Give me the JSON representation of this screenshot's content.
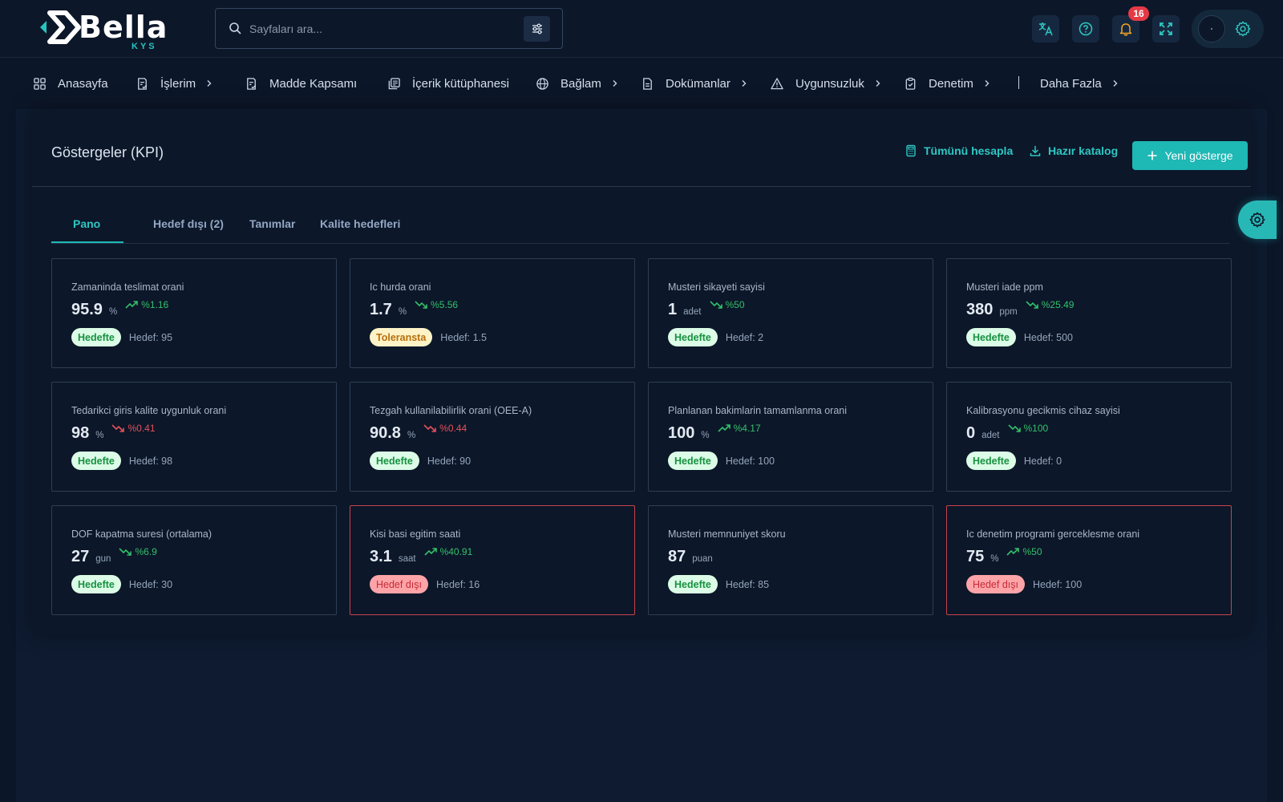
{
  "header": {
    "logo": {
      "name": "Bella",
      "sub": "KYS"
    },
    "search": {
      "placeholder": "Sayfaları ara..."
    },
    "notification_count": "16",
    "icons": [
      "translate-icon",
      "help-icon",
      "bell-icon",
      "fullscreen-icon",
      "gear-icon"
    ]
  },
  "nav": {
    "items": [
      {
        "label": "Anasayfa",
        "icon": "grid-icon",
        "chevron": false
      },
      {
        "label": "İşlerim",
        "icon": "task-icon",
        "chevron": true
      },
      {
        "label": "Madde Kapsamı",
        "icon": "checklist-icon",
        "chevron": false
      },
      {
        "label": "İçerik kütüphanesi",
        "icon": "library-icon",
        "chevron": false
      },
      {
        "label": "Bağlam",
        "icon": "globe-icon",
        "chevron": true
      },
      {
        "label": "Dokümanlar",
        "icon": "document-icon",
        "chevron": true
      },
      {
        "label": "Uygunsuzluk",
        "icon": "warning-icon",
        "chevron": true
      },
      {
        "label": "Denetim",
        "icon": "clipboard-icon",
        "chevron": true
      },
      {
        "label": "Daha Fazla",
        "icon": "",
        "chevron": true
      }
    ]
  },
  "page": {
    "title": "Göstergeler (KPI)",
    "actions": {
      "calculate_all": "Tümünü hesapla",
      "catalog": "Hazır katalog",
      "new_kpi": "Yeni gösterge"
    },
    "tabs": [
      {
        "label": "Pano",
        "active": true
      },
      {
        "label": "Hedef dışı (2)",
        "active": false
      },
      {
        "label": "Tanımlar",
        "active": false
      },
      {
        "label": "Kalite hedefleri",
        "active": false
      }
    ]
  },
  "colors": {
    "accent": "#1eb8b5",
    "trend_up": "#33c06a",
    "trend_down": "#e3515b",
    "alert_border": "#c8434d"
  },
  "kpis": [
    {
      "title": "Zamaninda teslimat orani",
      "value": "95.9",
      "unit": "%",
      "trend": "up",
      "change": "%1.16",
      "status": "Hedefte",
      "status_type": "ok",
      "target": "Hedef: 95",
      "alert": false
    },
    {
      "title": "Ic hurda orani",
      "value": "1.7",
      "unit": "%",
      "trend": "down-good",
      "change": "%5.56",
      "status": "Toleransta",
      "status_type": "warn",
      "target": "Hedef: 1.5",
      "alert": false
    },
    {
      "title": "Musteri sikayeti sayisi",
      "value": "1",
      "unit": "adet",
      "trend": "down-good",
      "change": "%50",
      "status": "Hedefte",
      "status_type": "ok",
      "target": "Hedef: 2",
      "alert": false
    },
    {
      "title": "Musteri iade ppm",
      "value": "380",
      "unit": "ppm",
      "trend": "down-good",
      "change": "%25.49",
      "status": "Hedefte",
      "status_type": "ok",
      "target": "Hedef: 500",
      "alert": false
    },
    {
      "title": "Tedarikci giris kalite uygunluk orani",
      "value": "98",
      "unit": "%",
      "trend": "down",
      "change": "%0.41",
      "status": "Hedefte",
      "status_type": "ok",
      "target": "Hedef: 98",
      "alert": false
    },
    {
      "title": "Tezgah kullanilabilirlik orani (OEE-A)",
      "value": "90.8",
      "unit": "%",
      "trend": "down",
      "change": "%0.44",
      "status": "Hedefte",
      "status_type": "ok",
      "target": "Hedef: 90",
      "alert": false
    },
    {
      "title": "Planlanan bakimlarin tamamlanma orani",
      "value": "100",
      "unit": "%",
      "trend": "up",
      "change": "%4.17",
      "status": "Hedefte",
      "status_type": "ok",
      "target": "Hedef: 100",
      "alert": false
    },
    {
      "title": "Kalibrasyonu gecikmis cihaz sayisi",
      "value": "0",
      "unit": "adet",
      "trend": "down-good",
      "change": "%100",
      "status": "Hedefte",
      "status_type": "ok",
      "target": "Hedef: 0",
      "alert": false
    },
    {
      "title": "DOF kapatma suresi (ortalama)",
      "value": "27",
      "unit": "gun",
      "trend": "down-good",
      "change": "%6.9",
      "status": "Hedefte",
      "status_type": "ok",
      "target": "Hedef: 30",
      "alert": false
    },
    {
      "title": "Kisi basi egitim saati",
      "value": "3.1",
      "unit": "saat",
      "trend": "up",
      "change": "%40.91",
      "status": "Hedef dışı",
      "status_type": "bad",
      "target": "Hedef: 16",
      "alert": true
    },
    {
      "title": "Musteri memnuniyet skoru",
      "value": "87",
      "unit": "puan",
      "trend": "",
      "change": "",
      "status": "Hedefte",
      "status_type": "ok",
      "target": "Hedef: 85",
      "alert": false
    },
    {
      "title": "Ic denetim programi gerceklesme orani",
      "value": "75",
      "unit": "%",
      "trend": "up",
      "change": "%50",
      "status": "Hedef dışı",
      "status_type": "bad",
      "target": "Hedef: 100",
      "alert": true
    }
  ]
}
